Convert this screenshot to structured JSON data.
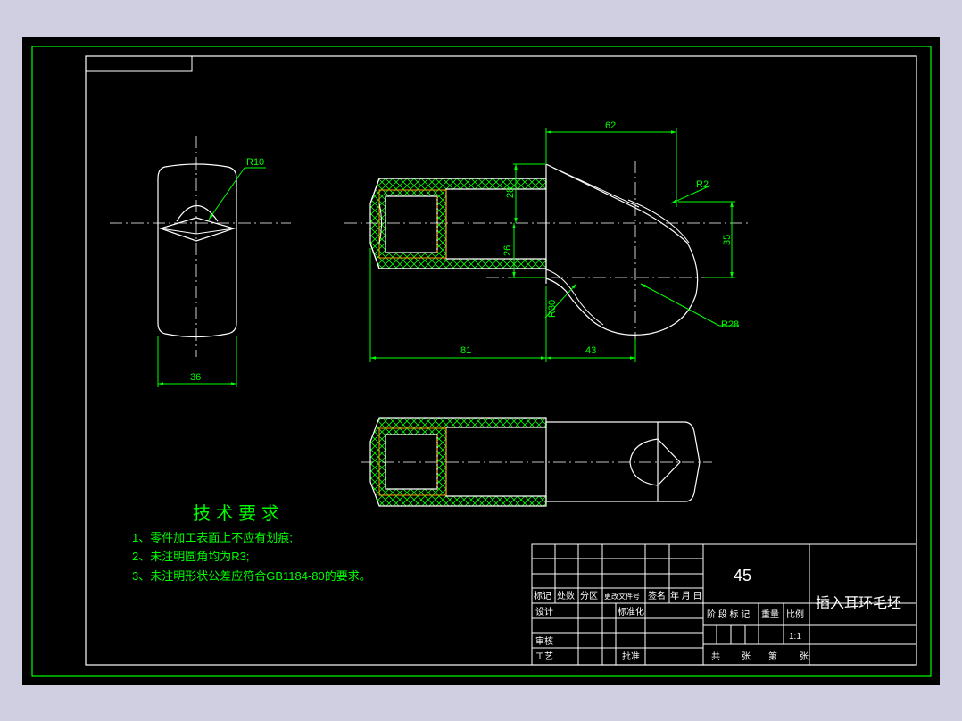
{
  "drawing": {
    "dims": {
      "r10": "R10",
      "w36": "36",
      "d62": "62",
      "r2": "R2",
      "d28": "28",
      "d26": "26",
      "d35": "35",
      "r30": "R30",
      "r28": "R28",
      "d81": "81",
      "d43": "43"
    },
    "tech_req": {
      "title": "技 术 要 求",
      "items": [
        "1、零件加工表面上不应有划痕;",
        "2、未注明圆角均为R3;",
        "3、未注明形状公差应符合GB1184-80的要求。"
      ]
    },
    "title_block": {
      "material": "45",
      "part_name": "插入耳环毛坯",
      "revision_headers": [
        "标记",
        "处数",
        "分区",
        "更改文件号",
        "签名",
        "年 月 日"
      ],
      "left_roles": [
        "设计",
        "审核",
        "工艺"
      ],
      "middle_roles": [
        "标准化",
        "",
        "批准"
      ],
      "stage_headers": [
        "阶 段 标 记",
        "重量",
        "比例"
      ],
      "scale": "1:1",
      "sheet_info": [
        "共",
        "张",
        "第",
        "张"
      ]
    },
    "colors": {
      "background": "#000000",
      "outline": "#ffffff",
      "dimension": "#00ff00",
      "hatch": "#00ff00",
      "section_edge": "#ff9900",
      "frame": "#00ff00"
    }
  }
}
